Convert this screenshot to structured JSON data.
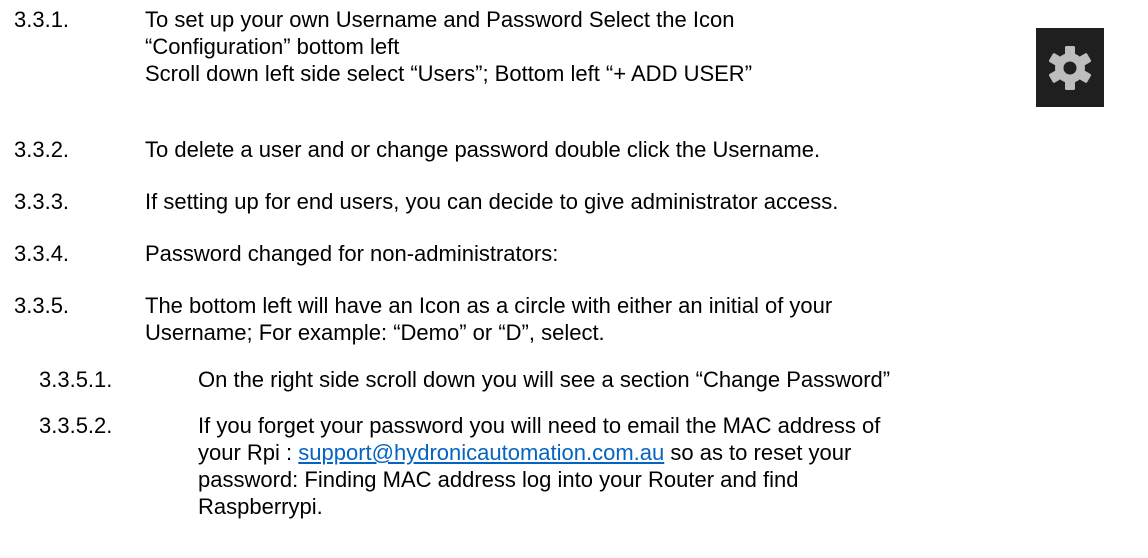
{
  "items": [
    {
      "number": "3.3.1.",
      "lines": [
        "To set up your own Username and Password Select the Icon",
        "“Configuration” bottom left",
        "Scroll down left side select “Users”; Bottom left “+ ADD USER”"
      ]
    },
    {
      "number": "3.3.2.",
      "lines": [
        "To delete a user and or change password double click the Username."
      ]
    },
    {
      "number": "3.3.3.",
      "lines": [
        "If setting up for end users, you can decide to give administrator access."
      ]
    },
    {
      "number": "3.3.4.",
      "lines": [
        "Password changed for non-administrators:"
      ]
    },
    {
      "number": "3.3.5.",
      "lines": [
        "The bottom left will have an Icon as a circle with either an initial of your",
        "Username; For example: “Demo” or “D”, select."
      ]
    }
  ],
  "subitems": [
    {
      "number": "3.3.5.1.",
      "lines": [
        "On the right side scroll down you will see a section “Change Password”"
      ]
    },
    {
      "number": "3.3.5.2.",
      "line1": "If you forget your password you will need to email the MAC address of",
      "line2_before": "your Rpi : ",
      "email": "support@hydronicautomation.com.au",
      "line2_after": " so as to reset your",
      "line3": "password: Finding MAC address log into your Router and find",
      "line4": "Raspberrypi."
    }
  ],
  "icon": {
    "name": "gear-icon",
    "background": "#1f1f1f",
    "color": "#bdbdbd"
  },
  "colors": {
    "text": "#000000",
    "link": "#0563c1"
  }
}
